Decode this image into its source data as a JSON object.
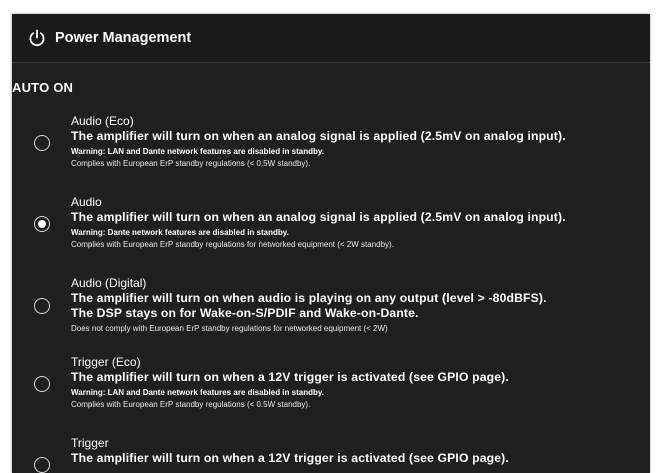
{
  "header": {
    "title": "Power Management",
    "icon": "power-icon"
  },
  "section": {
    "title": "AUTO ON"
  },
  "options": [
    {
      "title": "Audio (Eco)",
      "description": "The amplifier will turn on when an analog signal is applied (2.5mV on analog input).",
      "warning": "Warning: LAN and Dante network features are disabled in standby.",
      "note": "Complies with European ErP standby regulations (< 0.5W standby).",
      "selected": false
    },
    {
      "title": "Audio",
      "description": "The amplifier will turn on when an analog signal is applied (2.5mV on analog input).",
      "warning": "Warning: Dante network features are disabled in standby.",
      "note": "Complies with European ErP standby regulations for networked equipment (< 2W standby).",
      "selected": true
    },
    {
      "title": "Audio (Digital)",
      "description": "The amplifier will turn on when audio is playing on any output (level > -80dBFS).",
      "description2": "The DSP stays on for Wake-on-S/PDIF and Wake-on-Dante.",
      "note": "Does not comply with European ErP standby regulations for networked equipment (< 2W)",
      "selected": false
    },
    {
      "title": "Trigger (Eco)",
      "description": "The amplifier will turn on when a 12V trigger is activated (see GPIO page).",
      "warning": "Warning: LAN and Dante network features are disabled in standby.",
      "note": "Complies with European ErP standby regulations (< 0.5W standby).",
      "selected": false
    },
    {
      "title": "Trigger",
      "description": "The amplifier will turn on when a 12V trigger is activated (see GPIO page).",
      "selected": false
    }
  ],
  "colors": {
    "panel_bg": "#1f1f1f",
    "header_bg": "#1a1a1a",
    "text": "#ffffff"
  }
}
